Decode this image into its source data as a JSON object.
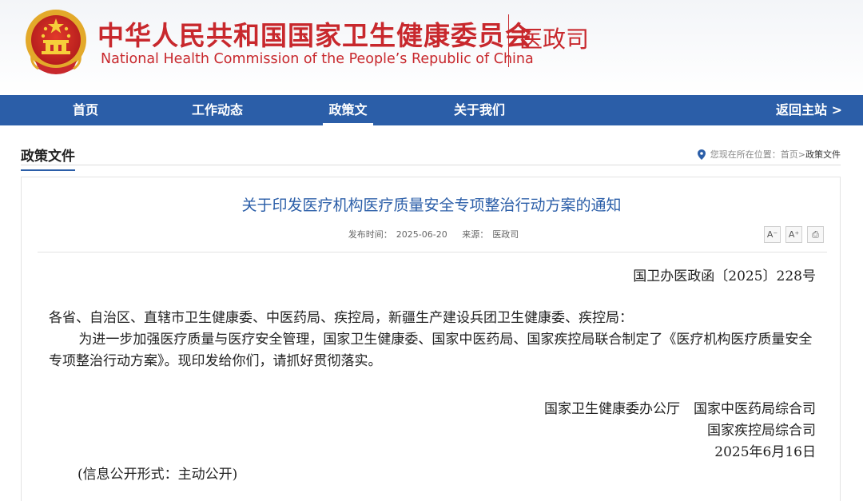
{
  "header": {
    "title_cn": "中华人民共和国国家卫生健康委员会",
    "title_en": "National Health Commission of the People’s  Republic of China",
    "department": "医政司",
    "colors": {
      "brand_red": "#c8282d",
      "nav_blue": "#2b5ea8"
    },
    "emblem_icon": "national-emblem"
  },
  "nav": {
    "items": [
      {
        "label": "首页"
      },
      {
        "label": "工作动态"
      },
      {
        "label": "政策文件"
      },
      {
        "label": "关于我们"
      }
    ],
    "active": "政策文件",
    "return_label": "返回主站 >"
  },
  "section": {
    "title": "政策文件",
    "breadcrumb": {
      "prefix": "您现在所在位置：",
      "home": "首页",
      "separator": ">",
      "current": "政策文件"
    }
  },
  "article": {
    "title": "关于印发医疗机构医疗质量安全专项整治行动方案的通知",
    "publish_label": "发布时间：",
    "publish_date": "2025-06-20",
    "source_label": "来源：",
    "source": "医政司",
    "tools": [
      {
        "icon": "font-decrease-icon",
        "glyph": "A⁻"
      },
      {
        "icon": "font-increase-icon",
        "glyph": "A⁺"
      },
      {
        "icon": "print-icon",
        "glyph": "⎙"
      }
    ],
    "doc_number": "国卫办医政函〔2025〕228号",
    "recipients": "各省、自治区、直辖市卫生健康委、中医药局、疾控局，新疆生产建设兵团卫生健康委、疾控局：",
    "body": "为进一步加强医疗质量与医疗安全管理，国家卫生健康委、国家中医药局、国家疾控局联合制定了《医疗机构医疗质量安全专项整治行动方案》。现印发给你们，请抓好贯彻落实。",
    "signatures": [
      "国家卫生健康委办公厅　国家中医药局综合司",
      "国家疾控局综合司"
    ],
    "sign_date": "2025年6月16日",
    "publication_form": "(信息公开形式：主动公开)"
  }
}
